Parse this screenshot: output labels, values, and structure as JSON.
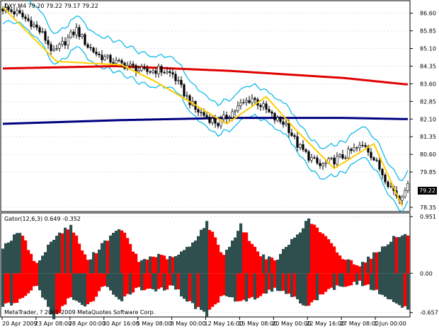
{
  "window": {
    "main_title": "DXY,M4  79.20 79.22 79.17 79.22",
    "indicator_title": "Gator(12,6,3) 0.649 -0.352",
    "copyright": "MetaTrader, ? 2001-2009 MetaQuotes Software Corp.",
    "current_price": "79.22"
  },
  "colors": {
    "background": "#ffffff",
    "grid": "#c8c8c8",
    "candles": "#000000",
    "bands": "#00b4e6",
    "ma_long": "#e00000",
    "ma_mid": "#000080",
    "zigzag": "#ffcc00",
    "gator_up": "#2f4f4f",
    "gator_down": "#ff0000",
    "price_tag_bg": "#000000",
    "price_tag_text": "#ffffff"
  },
  "chart_data": [
    {
      "type": "candlestick",
      "title": "DXY,M4  79.20 79.22 79.17 79.22",
      "y_ticks": [
        "86.60",
        "85.85",
        "85.10",
        "84.35",
        "83.60",
        "82.85",
        "82.10",
        "81.35",
        "80.60",
        "79.85",
        "78.35"
      ],
      "ylim": [
        78.2,
        87.1
      ],
      "grid": true,
      "current_price": 79.22,
      "x_tick_labels": [
        "20 Apr 2009",
        "23 Apr 08:00",
        "28 Apr 00:00",
        "30 Apr 16:00",
        "5 May 08:00",
        "8 May 00:00",
        "12 May 16:00",
        "15 May 08:00",
        "20 May 00:00",
        "22 May 16:00",
        "27 May 08:00",
        "1 Jun 00:00"
      ],
      "price_anchors": [
        [
          0,
          86.8
        ],
        [
          5,
          86.6
        ],
        [
          10,
          86.2
        ],
        [
          14,
          85.7
        ],
        [
          18,
          84.9
        ],
        [
          22,
          85.4
        ],
        [
          26,
          85.9
        ],
        [
          30,
          85.2
        ],
        [
          34,
          84.8
        ],
        [
          40,
          84.5
        ],
        [
          46,
          84.3
        ],
        [
          50,
          84.1
        ],
        [
          55,
          84.2
        ],
        [
          60,
          84.0
        ],
        [
          64,
          83.2
        ],
        [
          68,
          82.5
        ],
        [
          72,
          82.2
        ],
        [
          76,
          81.9
        ],
        [
          80,
          82.3
        ],
        [
          84,
          82.7
        ],
        [
          88,
          83.0
        ],
        [
          92,
          82.6
        ],
        [
          96,
          82.1
        ],
        [
          100,
          81.9
        ],
        [
          104,
          81.0
        ],
        [
          108,
          80.5
        ],
        [
          112,
          80.1
        ],
        [
          116,
          80.3
        ],
        [
          120,
          80.5
        ],
        [
          124,
          80.8
        ],
        [
          128,
          81.0
        ],
        [
          132,
          80.2
        ],
        [
          136,
          79.4
        ],
        [
          140,
          78.7
        ],
        [
          142,
          79.2
        ]
      ],
      "series": [
        {
          "name": "",
          "type": "bollinger_upper",
          "offset": 0.75
        },
        {
          "name": "",
          "type": "bollinger_lower",
          "offset": -0.55
        },
        {
          "name": "",
          "type": "moving_average",
          "values": [
            [
              0,
              84.25
            ],
            [
              40,
              84.35
            ],
            [
              80,
              84.15
            ],
            [
              120,
              83.85
            ],
            [
              142,
              83.58
            ]
          ]
        },
        {
          "name": "",
          "type": "moving_average",
          "values": [
            [
              0,
              81.9
            ],
            [
              40,
              82.05
            ],
            [
              80,
              82.15
            ],
            [
              120,
              82.15
            ],
            [
              142,
              82.1
            ]
          ]
        },
        {
          "name": "",
          "type": "zigzag",
          "values": [
            [
              0,
              86.85
            ],
            [
              19,
              84.55
            ],
            [
              42,
              84.4
            ],
            [
              53,
              83.75
            ],
            [
              68,
              82.7
            ],
            [
              79,
              81.9
            ],
            [
              93,
              83.05
            ],
            [
              103,
              81.7
            ],
            [
              117,
              80.0
            ],
            [
              131,
              81.05
            ],
            [
              141,
              78.4
            ]
          ]
        }
      ]
    },
    {
      "type": "bar",
      "title": "Gator(12,6,3) 0.649 -0.352",
      "y_ticks": [
        "0.951",
        "0.00",
        "-0.657"
      ],
      "ylim": [
        -0.72,
        1.0
      ],
      "series": [
        {
          "name": "",
          "side": "upper",
          "values": [
            [
              0,
              0.45
            ],
            [
              6,
              0.7
            ],
            [
              12,
              0.15
            ],
            [
              18,
              0.6
            ],
            [
              24,
              0.8
            ],
            [
              30,
              0.2
            ],
            [
              36,
              0.55
            ],
            [
              42,
              0.75
            ],
            [
              48,
              0.2
            ],
            [
              54,
              0.3
            ],
            [
              60,
              0.25
            ],
            [
              66,
              0.45
            ],
            [
              72,
              0.85
            ],
            [
              78,
              0.3
            ],
            [
              84,
              0.8
            ],
            [
              90,
              0.35
            ],
            [
              96,
              0.2
            ],
            [
              102,
              0.55
            ],
            [
              108,
              0.9
            ],
            [
              114,
              0.6
            ],
            [
              120,
              0.25
            ],
            [
              126,
              0.15
            ],
            [
              132,
              0.35
            ],
            [
              138,
              0.6
            ],
            [
              143,
              0.65
            ]
          ]
        },
        {
          "name": "",
          "side": "lower",
          "values": [
            [
              0,
              0.55
            ],
            [
              6,
              0.45
            ],
            [
              12,
              0.2
            ],
            [
              18,
              0.75
            ],
            [
              24,
              0.4
            ],
            [
              30,
              0.55
            ],
            [
              36,
              0.2
            ],
            [
              42,
              0.45
            ],
            [
              48,
              0.25
            ],
            [
              54,
              0.3
            ],
            [
              60,
              0.2
            ],
            [
              66,
              0.5
            ],
            [
              72,
              0.7
            ],
            [
              78,
              0.35
            ],
            [
              84,
              0.5
            ],
            [
              90,
              0.4
            ],
            [
              96,
              0.25
            ],
            [
              102,
              0.4
            ],
            [
              108,
              0.55
            ],
            [
              114,
              0.3
            ],
            [
              120,
              0.2
            ],
            [
              126,
              0.15
            ],
            [
              132,
              0.3
            ],
            [
              138,
              0.5
            ],
            [
              143,
              0.6
            ]
          ]
        }
      ]
    }
  ]
}
